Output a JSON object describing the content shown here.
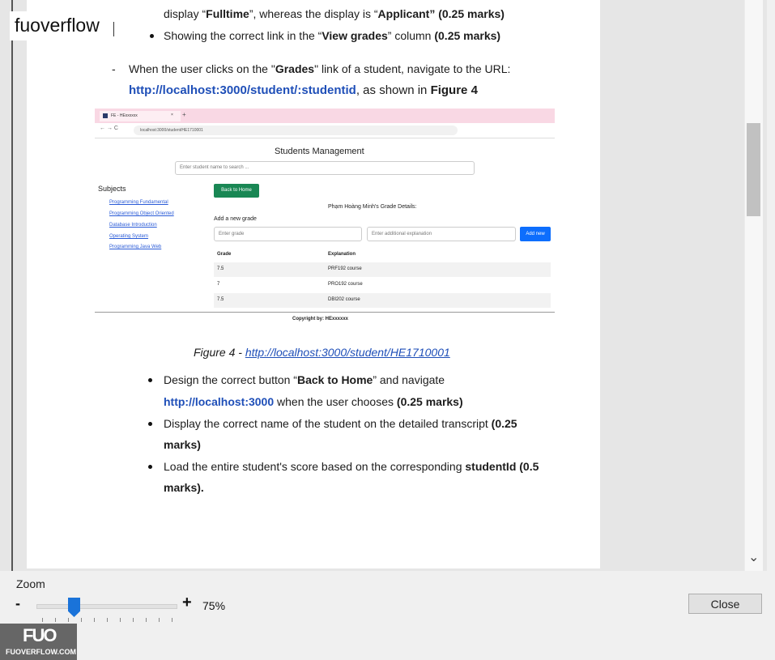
{
  "brand": {
    "name": "fuoverflow"
  },
  "watermark": {
    "mark": "FUO",
    "site": "FUOVERFLOW.COM"
  },
  "doc": {
    "line1_pre": "display “",
    "line1_b1": "Fulltime",
    "line1_mid": "”, whereas the display is “",
    "line1_b2": "Applicant",
    "line1_end": "” (0.25 marks)",
    "bullet1_pre": "Showing the correct link in the “",
    "bullet1_b": "View grades",
    "bullet1_mid": "” column ",
    "bullet1_end": "(0.25 marks)",
    "dash": "-",
    "para_pre": "When the user clicks on the \"",
    "para_b": "Grades",
    "para_end": "\" link of a student, navigate to the URL:",
    "url_line_link": "http://localhost:3000/student/:studentid",
    "url_line_mid": ", as shown in ",
    "url_line_fig": "Figure 4",
    "caption_pre": "Figure 4 - ",
    "caption_link": "http://localhost:3000/student/HE1710001",
    "b2_pre": "Design the correct button “",
    "b2_b": "Back to Home",
    "b2_end": "” and navigate",
    "b2_link": "http://localhost:3000",
    "b2_mid": " when the user chooses ",
    "b2_marks": "(0.25 marks)",
    "b3_text": "Display the correct name of the student on the detailed transcript ",
    "b3_marks1": "(0.25",
    "b3_marks2": "marks)",
    "b4_pre": "Load the entire student's score based on the corresponding ",
    "b4_b": "studentId (0.5",
    "b4_end": "marks)."
  },
  "screenshot": {
    "tab_title": "FE - HExxxxxx",
    "url": "localhost:3000/student/HE1710001",
    "page_title": "Students Management",
    "search_placeholder": "Enter student name to search ...",
    "subjects_heading": "Subjects",
    "subjects": [
      "Programming Fundamental",
      "Programming Object Oriented",
      "Database Introduction",
      "Operating System",
      "Programming Java Web"
    ],
    "back_button": "Back to Home",
    "details_title": "Phạm Hoàng Minh's Grade Details:",
    "add_grade_label": "Add a new grade",
    "grade_placeholder": "Enter grade",
    "explanation_placeholder": "Enter additional explanation",
    "add_button": "Add new",
    "columns": [
      "Grade",
      "Explanation"
    ],
    "rows": [
      [
        "7.5",
        "PRF192 course"
      ],
      [
        "7",
        "PRO192 course"
      ],
      [
        "7.5",
        "DBI202 course"
      ]
    ],
    "footer": "Copyright by: HExxxxxx"
  },
  "zoom": {
    "label": "Zoom",
    "minus": "-",
    "plus": "+",
    "value": "75%",
    "level_percent": 75
  },
  "close_label": "Close",
  "colors": {
    "link": "#1f4fb8",
    "slider": "#1a73d9",
    "tab_bar": "#f9d8e4",
    "btn_green": "#198754",
    "btn_blue": "#0d6efd"
  }
}
